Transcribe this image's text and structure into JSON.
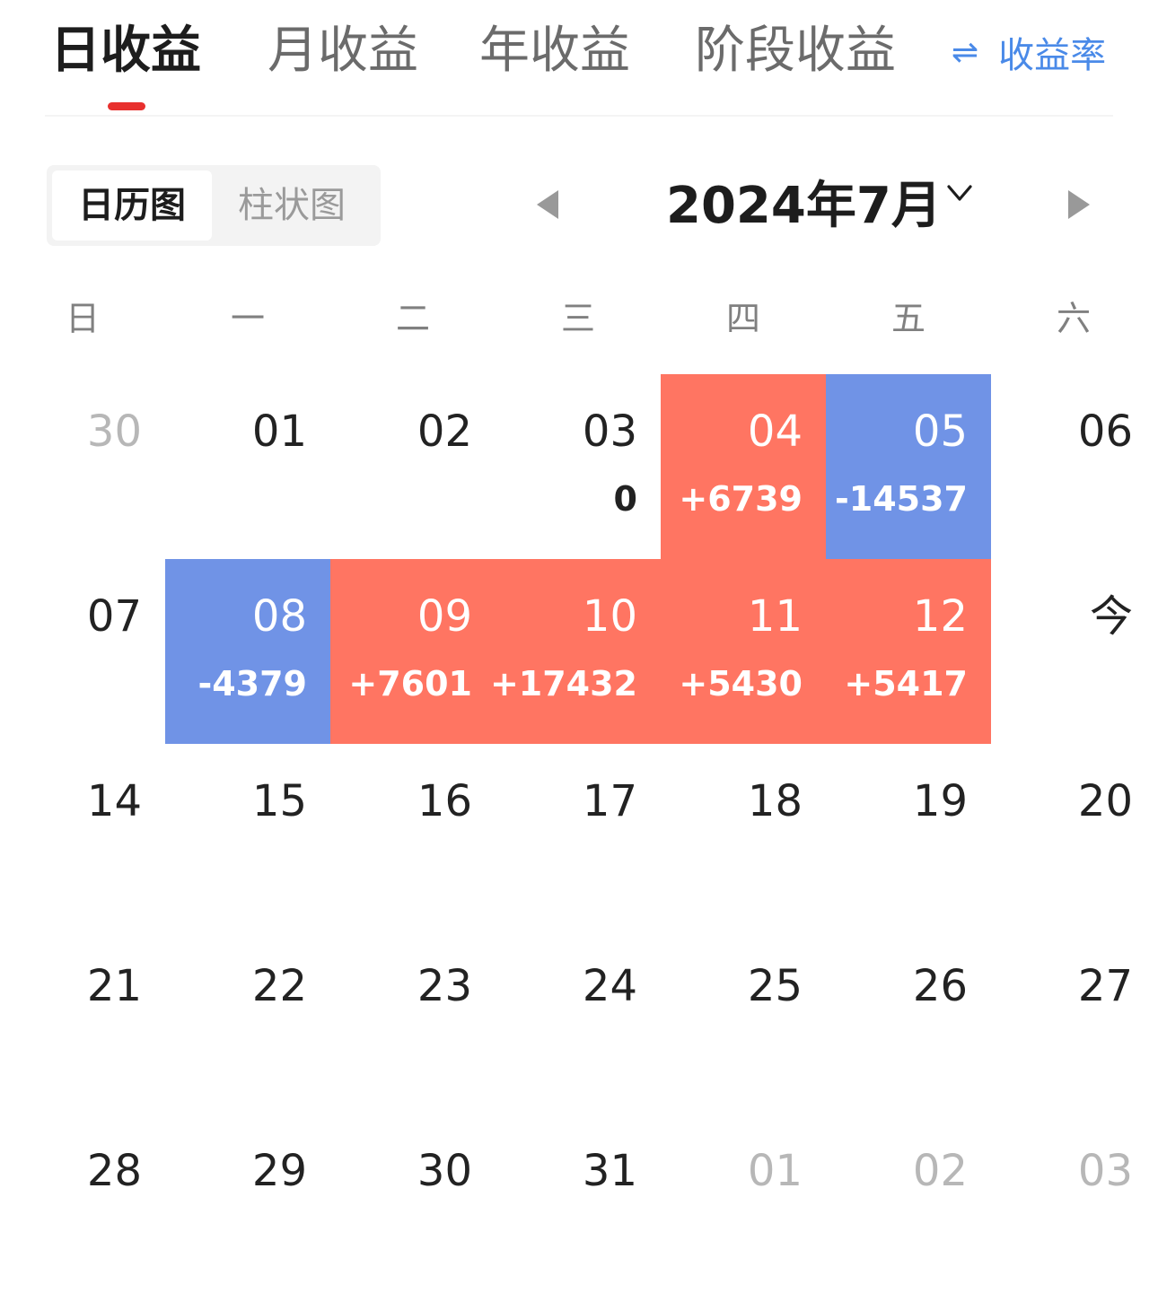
{
  "header": {
    "tabs": [
      {
        "label": "日收益",
        "active": true
      },
      {
        "label": "月收益",
        "active": false
      },
      {
        "label": "年收益",
        "active": false
      },
      {
        "label": "阶段收益",
        "active": false
      }
    ],
    "rate_toggle": {
      "icon": "swap-icon",
      "glyph": "⇌",
      "label": "收益率"
    }
  },
  "view_switch": {
    "options": [
      {
        "label": "日历图",
        "active": true
      },
      {
        "label": "柱状图",
        "active": false
      }
    ]
  },
  "month_nav": {
    "label": "2024年7月",
    "prev_icon": "caret-left-icon",
    "next_icon": "caret-right-icon",
    "dropdown_icon": "chevron-down-icon"
  },
  "weekdays": [
    "日",
    "一",
    "二",
    "三",
    "四",
    "五",
    "六"
  ],
  "weeks": [
    [
      {
        "day": "30",
        "dim": true
      },
      {
        "day": "01"
      },
      {
        "day": "02"
      },
      {
        "day": "03",
        "value": "0"
      },
      {
        "day": "04",
        "value": "+6739",
        "status": "profit"
      },
      {
        "day": "05",
        "value": "-14537",
        "status": "loss"
      },
      {
        "day": "06"
      }
    ],
    [
      {
        "day": "07"
      },
      {
        "day": "08",
        "value": "-4379",
        "status": "loss"
      },
      {
        "day": "09",
        "value": "+7601",
        "status": "profit"
      },
      {
        "day": "10",
        "value": "+17432",
        "status": "profit"
      },
      {
        "day": "11",
        "value": "+5430",
        "status": "profit"
      },
      {
        "day": "12",
        "value": "+5417",
        "status": "profit"
      },
      {
        "day": "今"
      }
    ],
    [
      {
        "day": "14"
      },
      {
        "day": "15"
      },
      {
        "day": "16"
      },
      {
        "day": "17"
      },
      {
        "day": "18"
      },
      {
        "day": "19"
      },
      {
        "day": "20"
      }
    ],
    [
      {
        "day": "21"
      },
      {
        "day": "22"
      },
      {
        "day": "23"
      },
      {
        "day": "24"
      },
      {
        "day": "25"
      },
      {
        "day": "26"
      },
      {
        "day": "27"
      }
    ],
    [
      {
        "day": "28"
      },
      {
        "day": "29"
      },
      {
        "day": "30"
      },
      {
        "day": "31"
      },
      {
        "day": "01",
        "dim": true
      },
      {
        "day": "02",
        "dim": true
      },
      {
        "day": "03",
        "dim": true
      }
    ]
  ],
  "colors": {
    "profit": "#ff7562",
    "loss": "#7093e6",
    "accent_red": "#e8302e",
    "accent_blue": "#4a8ae8"
  }
}
